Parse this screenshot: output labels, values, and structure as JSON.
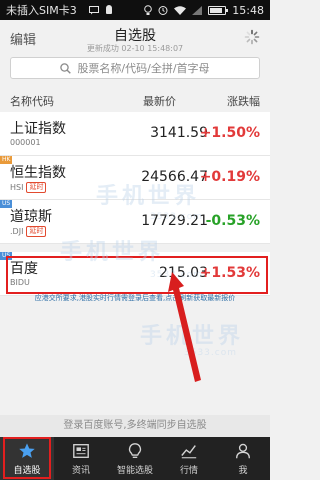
{
  "status_bar": {
    "carrier": "未插入SIM卡3",
    "time": "15:48"
  },
  "header": {
    "edit_label": "编辑",
    "title": "自选股",
    "subtitle": "更新成功 02-10 15:48:07"
  },
  "search": {
    "placeholder": "股票名称/代码/全拼/首字母"
  },
  "columns": {
    "code": "名称代码",
    "price": "最新价",
    "change": "涨跌幅"
  },
  "stocks": [
    {
      "name": "上证指数",
      "code": "000001",
      "badge": "",
      "price": "3141.59",
      "change": "+1.50%",
      "direction": "up"
    },
    {
      "name": "恒生指数",
      "code": "HSI",
      "badge": "延时",
      "price": "24566.47",
      "change": "+0.19%",
      "direction": "up"
    },
    {
      "name": "道琼斯",
      "code": ".DJI",
      "badge": "延时",
      "price": "17729.21",
      "change": "-0.53%",
      "direction": "down"
    },
    {
      "name": "百度",
      "code": "BIDU",
      "badge": "",
      "price": "215.03",
      "change": "+1.53%",
      "direction": "up"
    }
  ],
  "notice": "应港交所要求,港股实时行情需登录后查看,点击刷新获取最新报价",
  "watermark": {
    "main": "手机世界",
    "sub": "3533.com"
  },
  "promo": "登录百度账号,多终端同步自选股",
  "tabs": [
    {
      "label": "自选股",
      "icon": "star-icon",
      "active": true
    },
    {
      "label": "资讯",
      "icon": "news-icon",
      "active": false
    },
    {
      "label": "智能选股",
      "icon": "bulb-icon",
      "active": false
    },
    {
      "label": "行情",
      "icon": "chart-icon",
      "active": false
    },
    {
      "label": "我",
      "icon": "user-icon",
      "active": false
    }
  ],
  "colors": {
    "up": "#e23a3a",
    "down": "#28a228",
    "highlight": "#e21f1f",
    "tabbar": "#222222"
  }
}
